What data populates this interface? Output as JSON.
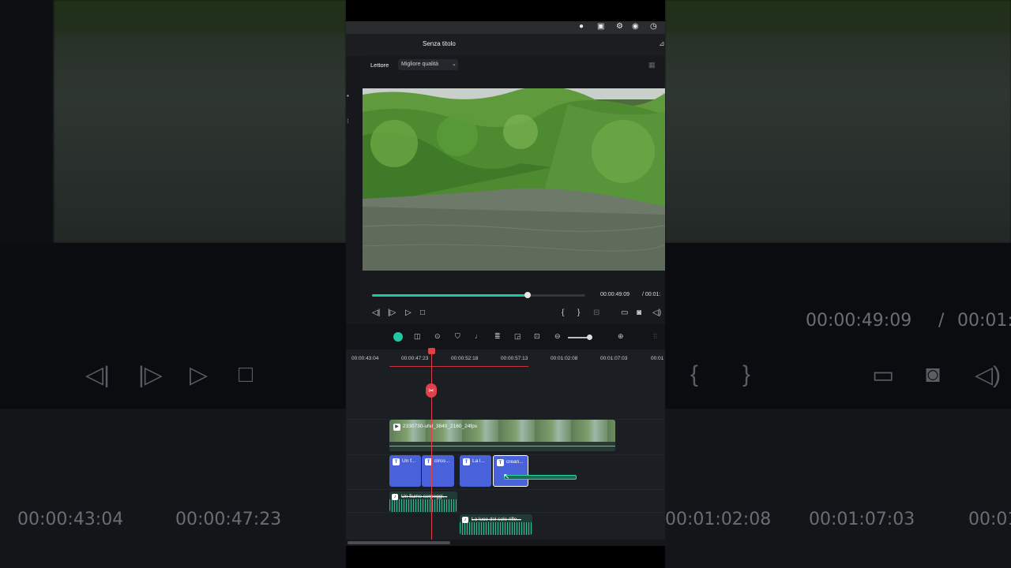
{
  "app": {
    "title": "Senza titolo",
    "player_label": "Lettore",
    "quality_value": "Migliore qualità"
  },
  "playback": {
    "current_time": "00:00:49:09",
    "total_time": "/  00:01:",
    "progress": 0.73
  },
  "ruler": {
    "ticks": [
      "00:00:43:04",
      "00:00:47:23",
      "00:00:52:18",
      "00:00:57:13",
      "00:01:02:08",
      "00:01:07:03",
      "00:01"
    ]
  },
  "tracks": {
    "video_clip": {
      "name": "2330730-uhd_3840_2160_24fps"
    },
    "text_clips": [
      {
        "label": "Un f..."
      },
      {
        "label": "circo..."
      },
      {
        "label": "La l..."
      },
      {
        "label": "crean..."
      }
    ],
    "audio_clips": [
      {
        "label": "Un fiume serpeggi..."
      },
      {
        "label": "La luce del sole rifle..."
      }
    ]
  },
  "background": {
    "big_times": [
      "00:00:43:04",
      "00:00:47:23",
      "00:00:49:09",
      "/",
      "00:01:",
      "00:01:02:08",
      "00:01:07:03",
      "00:01"
    ]
  },
  "colors": {
    "accent": "#1fc7a3",
    "playhead": "#e0404a",
    "text_clip": "#4a62d9"
  },
  "icons": [
    "record-icon",
    "screen-icon",
    "settings-icon",
    "play-circle-icon",
    "history-icon",
    "step-back-icon",
    "step-forward-icon",
    "play-icon",
    "stop-icon",
    "mark-in-icon",
    "mark-out-icon",
    "monitor-icon",
    "camera-icon",
    "volume-icon",
    "scissors-icon",
    "zoom-out-icon",
    "zoom-in-icon"
  ]
}
